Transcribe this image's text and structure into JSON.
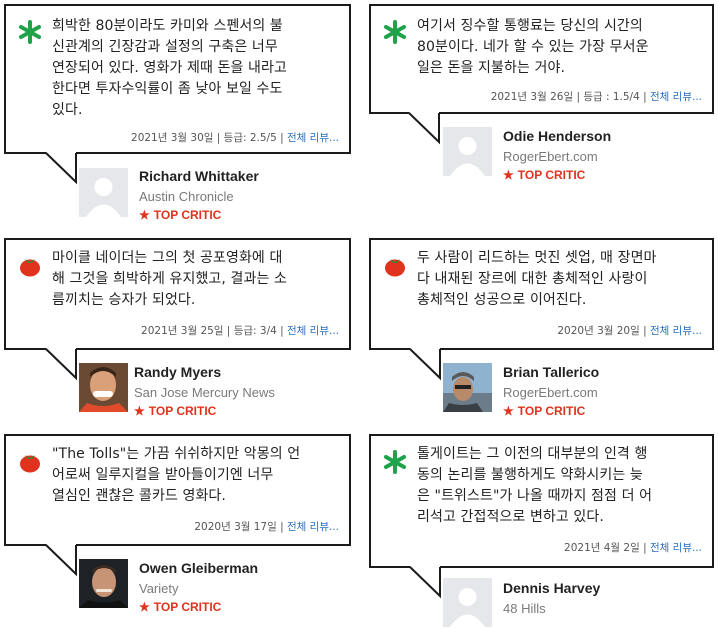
{
  "reviews": [
    {
      "icon": "green-splat-icon",
      "text_lines": [
        "희박한 80분이라도 카미와 스펜서의 불",
        "신관계의 긴장감과 설정의 구축은 너무",
        "연장되어 있다. 영화가 제때 돈을 내라고",
        "한다면 투자수익률이 좀 낮아 보일 수도",
        "있다."
      ],
      "date": "2021년 3월 30일",
      "rating": "등급: 2.5/5",
      "full_review": "전체 리뷰...",
      "critic": "Richard Whittaker",
      "publication": "Austin Chronicle",
      "badge": "TOP CRITIC"
    },
    {
      "icon": "green-splat-icon",
      "text_lines": [
        "여기서 징수할 통행료는 당신의 시간의",
        "80분이다. 네가 할 수 있는 가장 무서운",
        "일은 돈을 지불하는 거야."
      ],
      "date": "2021년 3월 26일",
      "rating": "등급 : 1.5/4",
      "full_review": "전체 리뷰...",
      "critic": "Odie Henderson",
      "publication": "RogerEbert.com",
      "badge": "TOP CRITIC"
    },
    {
      "icon": "red-tomato-icon",
      "text_lines": [
        "마이클 네이더는 그의 첫 공포영화에 대",
        "해 그것을 희박하게 유지했고, 결과는 소",
        "름끼치는 승자가 되었다."
      ],
      "date": "2021년 3월 25일",
      "rating": "등급: 3/4",
      "full_review": "전체 리뷰...",
      "critic": "Randy Myers",
      "publication": "San Jose Mercury News",
      "badge": "TOP CRITIC"
    },
    {
      "icon": "red-tomato-icon",
      "text_lines": [
        "두 사람이 리드하는 멋진 셋업, 매 장면마",
        "다 내재된 장르에 대한 총체적인 사랑이",
        "총체적인 성공으로 이어진다."
      ],
      "date": "2020년 3월 20일",
      "rating": "",
      "full_review": "전체 리뷰...",
      "critic": "Brian Tallerico",
      "publication": "RogerEbert.com",
      "badge": "TOP CRITIC"
    },
    {
      "icon": "red-tomato-icon",
      "text_lines": [
        "\"The Tolls\"는 가끔 쉬쉬하지만 악몽의 언",
        "어로써 일루지컬을 받아들이기엔 너무",
        "열심인 괜찮은 콜카드 영화다."
      ],
      "date": "2020년 3월 17일",
      "rating": "",
      "full_review": "전체 리뷰...",
      "critic": "Owen Gleiberman",
      "publication": "Variety",
      "badge": "TOP CRITIC"
    },
    {
      "icon": "green-splat-icon",
      "text_lines": [
        "톨게이트는 그 이전의 대부분의 인격 행",
        "동의 논리를 불행하게도 약화시키는 늦",
        "은 \"트위스트\"가 나올 때까지 점점 더 어",
        "리석고 간접적으로 변하고 있다."
      ],
      "date": "2021년 4월 2일",
      "rating": "",
      "full_review": "전체 리뷰...",
      "critic": "Dennis Harvey",
      "publication": "48 Hills",
      "badge": ""
    }
  ],
  "colors": {
    "accent_red": "#e0321c",
    "splat_green": "#1fa34a",
    "link_blue": "#2a6fbd",
    "border": "#1b1b1b"
  }
}
